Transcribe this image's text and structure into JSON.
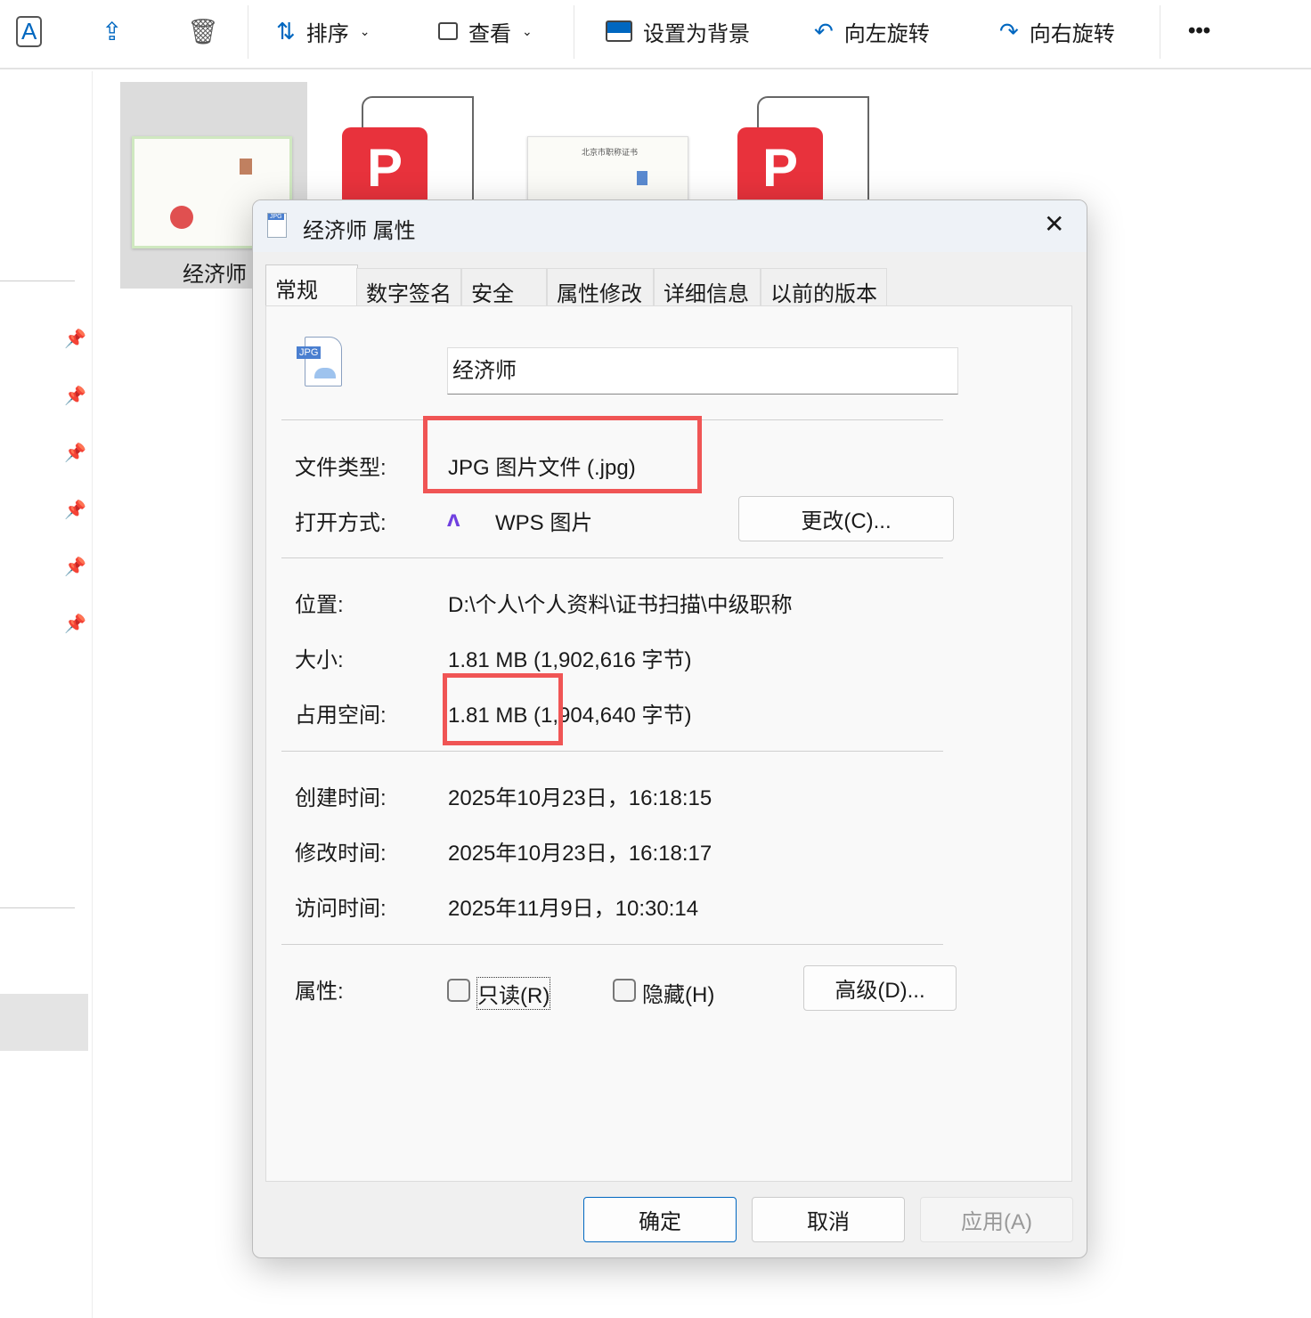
{
  "toolbar": {
    "sort": "排序",
    "view": "查看",
    "set_background": "设置为背景",
    "rotate_left": "向左旋转",
    "rotate_right": "向右旋转",
    "more": "•••"
  },
  "files": {
    "selected_name": "经济师",
    "cert_title": "北京市职称证书"
  },
  "dialog": {
    "title": "经济师 属性",
    "close": "✕",
    "tabs": [
      "常规",
      "数字签名",
      "安全",
      "属性修改",
      "详细信息",
      "以前的版本"
    ],
    "icon_badge": "JPG",
    "filename": "经济师",
    "file_type_label": "文件类型:",
    "file_type": "JPG 图片文件 (.jpg)",
    "open_with_label": "打开方式:",
    "open_with": "WPS 图片",
    "change_button": "更改(C)...",
    "location_label": "位置:",
    "location": "D:\\个人\\个人资料\\证书扫描\\中级职称",
    "size_label": "大小:",
    "size": "1.81 MB (1,902,616 字节)",
    "disk_size_label": "占用空间:",
    "disk_size": "1.81 MB (1,904,640 字节)",
    "created_label": "创建时间:",
    "created": "2025年10月23日，16:18:15",
    "modified_label": "修改时间:",
    "modified": "2025年10月23日，16:18:17",
    "accessed_label": "访问时间:",
    "accessed": "2025年11月9日，10:30:14",
    "attributes_label": "属性:",
    "readonly": "只读(R)",
    "hidden": "隐藏(H)",
    "advanced_button": "高级(D)...",
    "ok": "确定",
    "cancel": "取消",
    "apply": "应用(A)"
  },
  "colors": {
    "highlight": "#f05555",
    "accent": "#0067c0"
  }
}
